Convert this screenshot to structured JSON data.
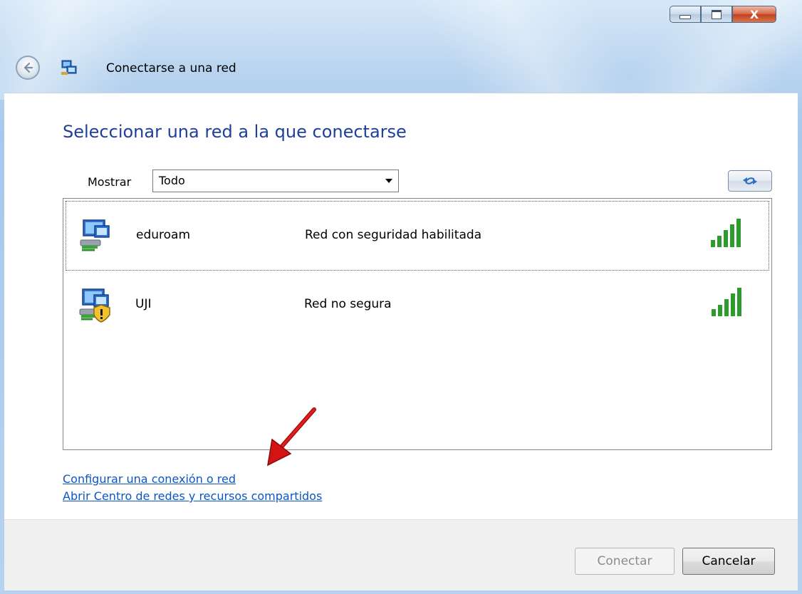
{
  "window": {
    "title": "Conectarse a una red",
    "close_glyph": "X"
  },
  "icons": {
    "back": "back-arrow-icon",
    "app": "network-connect-icon",
    "refresh": "refresh-icon"
  },
  "main": {
    "heading": "Seleccionar una red a la que conectarse",
    "show_label": "Mostrar",
    "show_value": "Todo",
    "networks": [
      {
        "name": "eduroam",
        "status": "Red con seguridad habilitada",
        "secure": true,
        "focused": true
      },
      {
        "name": "UJI",
        "status": "Red no segura",
        "secure": false,
        "focused": false
      }
    ],
    "links": [
      "Configurar una conexión o red",
      "Abrir Centro de redes y recursos compartidos"
    ]
  },
  "footer": {
    "connect_label": "Conectar",
    "cancel_label": "Cancelar"
  },
  "colors": {
    "heading": "#1e3f9c",
    "link": "#0b56c4",
    "signal": "#2e9b2e",
    "annotation_arrow": "#d01010"
  }
}
